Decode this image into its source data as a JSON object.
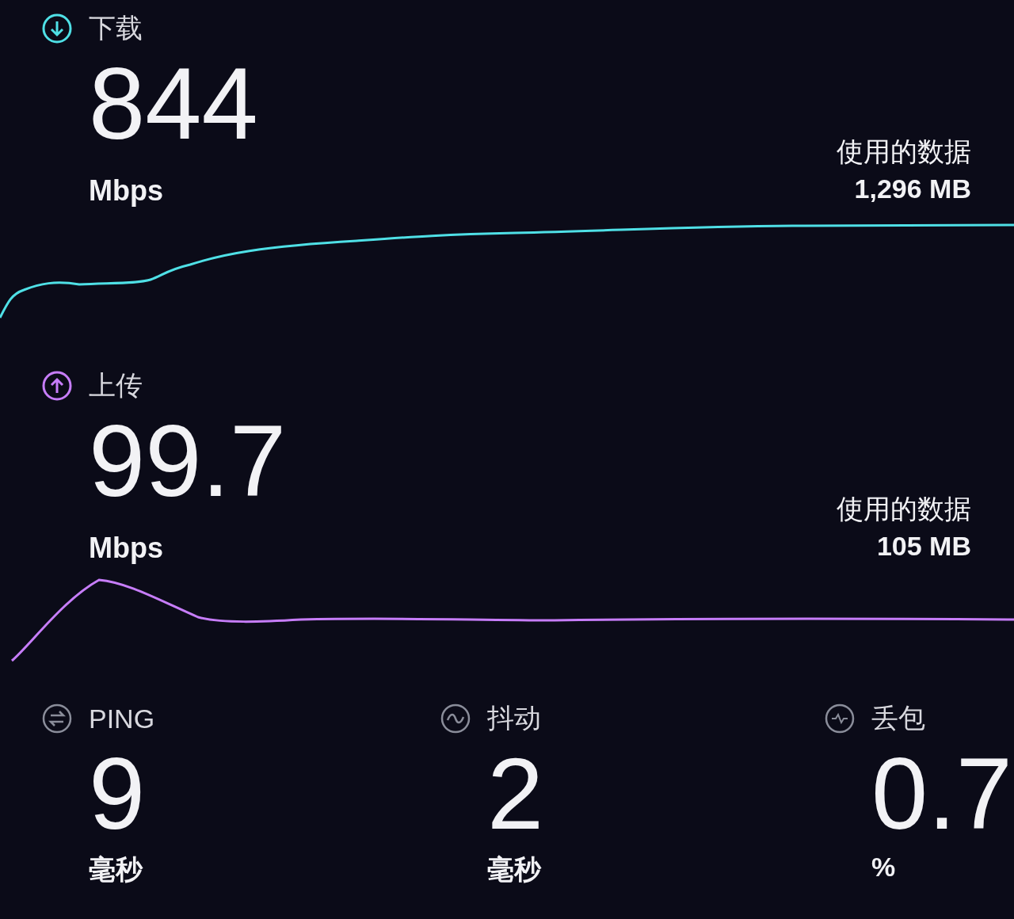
{
  "tests": [
    {
      "kind": "download",
      "label": "下载",
      "color": "#4fe0e6",
      "value": "844",
      "unit": "Mbps",
      "data_label": "使用的数据",
      "data_value": "1,296 MB"
    },
    {
      "kind": "upload",
      "label": "上传",
      "color": "#c77dfa",
      "value": "99.7",
      "unit": "Mbps",
      "data_label": "使用的数据",
      "data_value": "105 MB"
    }
  ],
  "metrics": [
    {
      "kind": "ping",
      "label": "PING",
      "value": "9",
      "unit": "毫秒"
    },
    {
      "kind": "jitter",
      "label": "抖动",
      "value": "2",
      "unit": "毫秒"
    },
    {
      "kind": "loss",
      "label": "丢包",
      "value": "0.7",
      "unit": "%"
    }
  ]
}
